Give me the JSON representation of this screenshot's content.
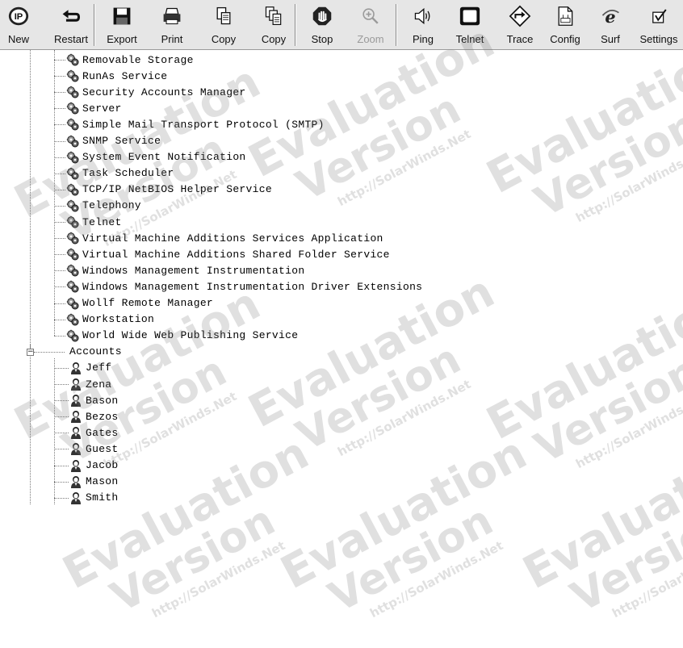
{
  "toolbar": {
    "buttons": [
      {
        "label": "New",
        "icon": "ip-logo-icon"
      },
      {
        "label": "Restart",
        "icon": "restart-arrow-icon"
      },
      {
        "label": "Export",
        "icon": "floppy-disk-icon"
      },
      {
        "label": "Print",
        "icon": "printer-icon"
      },
      {
        "label": "Copy",
        "icon": "copy-icon"
      },
      {
        "label": "Copy",
        "icon": "copy-multi-icon"
      },
      {
        "label": "Stop",
        "icon": "stop-hand-icon"
      },
      {
        "label": "Zoom",
        "icon": "zoom-icon",
        "disabled": true
      },
      {
        "label": "Ping",
        "icon": "speaker-icon"
      },
      {
        "label": "Telnet",
        "icon": "telnet-terminal-icon"
      },
      {
        "label": "Trace",
        "icon": "trace-diamond-icon"
      },
      {
        "label": "Config",
        "icon": "config-document-icon"
      },
      {
        "label": "Surf",
        "icon": "browser-e-icon"
      },
      {
        "label": "Settings",
        "icon": "settings-check-icon"
      }
    ]
  },
  "tree": {
    "services": [
      "Removable Storage",
      "RunAs Service",
      "Security Accounts Manager",
      "Server",
      "Simple Mail Transport Protocol (SMTP)",
      "SNMP Service",
      "System Event Notification",
      "Task Scheduler",
      "TCP/IP NetBIOS Helper Service",
      "Telephony",
      "Telnet",
      "Virtual Machine Additions Services Application",
      "Virtual Machine Additions Shared Folder Service",
      "Windows Management Instrumentation",
      "Windows Management Instrumentation Driver Extensions",
      "Wollf Remote Manager",
      "Workstation",
      "World Wide Web Publishing Service"
    ],
    "accounts_label": "Accounts",
    "accounts_expander": "−",
    "accounts": [
      "Jeff",
      "Zena",
      "Bason",
      "Bezos",
      "Gates",
      "Guest",
      "Jacob",
      "Mason",
      "Smith"
    ]
  },
  "watermark": {
    "line1": "Evaluation",
    "line2": "Version",
    "line3": "http://SolarWinds.Net"
  }
}
